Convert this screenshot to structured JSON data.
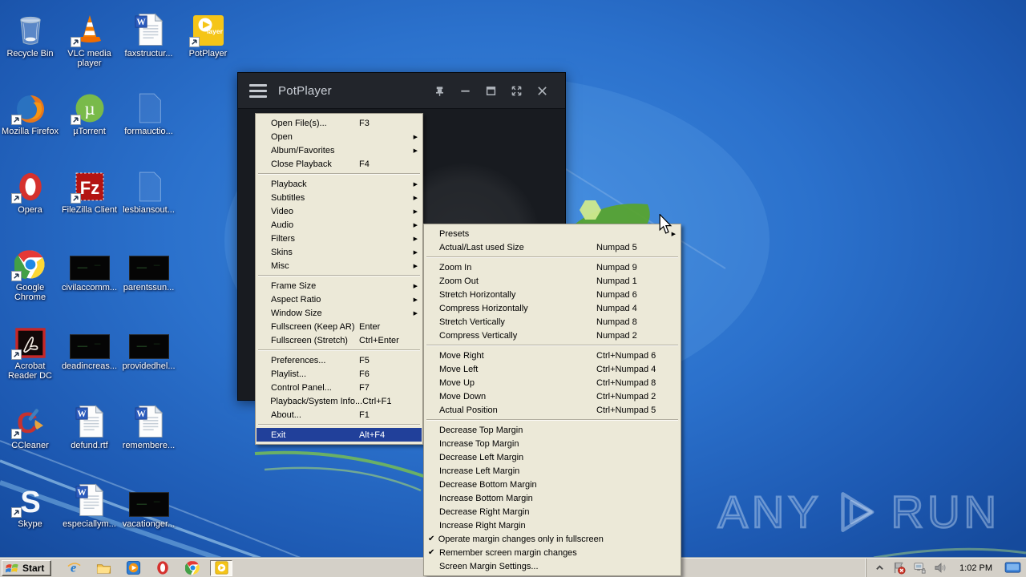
{
  "colors": {
    "menu_highlight": "#21409a",
    "menu_background": "#ece9d8",
    "titlebar": "#22252b",
    "taskbar": "#d4d0c8",
    "potplayer_yellow": "#f5c518",
    "wallpaper_base": "#2b71cc"
  },
  "window": {
    "title": "PotPlayer",
    "titlebar_icons": [
      "pin-icon",
      "minimize-icon",
      "maximize-icon",
      "fullscreen-icon",
      "close-icon"
    ]
  },
  "menus": {
    "main": {
      "items": [
        {
          "label": "Open File(s)...",
          "shortcut": "F3"
        },
        {
          "label": "Open",
          "submenu": true
        },
        {
          "label": "Album/Favorites",
          "submenu": true
        },
        {
          "label": "Close Playback",
          "shortcut": "F4"
        },
        {
          "separator": true
        },
        {
          "label": "Playback",
          "submenu": true
        },
        {
          "label": "Subtitles",
          "submenu": true
        },
        {
          "label": "Video",
          "submenu": true
        },
        {
          "label": "Audio",
          "submenu": true
        },
        {
          "label": "Filters",
          "submenu": true
        },
        {
          "label": "Skins",
          "submenu": true
        },
        {
          "label": "Misc",
          "submenu": true
        },
        {
          "separator": true
        },
        {
          "label": "Frame Size",
          "submenu": true
        },
        {
          "label": "Aspect Ratio",
          "submenu": true
        },
        {
          "label": "Window Size",
          "submenu": true
        },
        {
          "label": "Fullscreen (Keep AR)",
          "shortcut": "Enter"
        },
        {
          "label": "Fullscreen (Stretch)",
          "shortcut": "Ctrl+Enter"
        },
        {
          "separator": true
        },
        {
          "label": "Preferences...",
          "shortcut": "F5"
        },
        {
          "label": "Playlist...",
          "shortcut": "F6"
        },
        {
          "label": "Control Panel...",
          "shortcut": "F7"
        },
        {
          "label": "Playback/System Info...",
          "shortcut": "Ctrl+F1"
        },
        {
          "label": "About...",
          "shortcut": "F1"
        },
        {
          "separator": true
        },
        {
          "label": "Exit",
          "shortcut": "Alt+F4",
          "highlighted": true
        }
      ]
    },
    "window_size": {
      "items": [
        {
          "label": "Presets",
          "submenu": true
        },
        {
          "label": "Actual/Last used Size",
          "shortcut": "Numpad 5"
        },
        {
          "separator": true
        },
        {
          "label": "Zoom In",
          "shortcut": "Numpad 9"
        },
        {
          "label": "Zoom Out",
          "shortcut": "Numpad 1"
        },
        {
          "label": "Stretch Horizontally",
          "shortcut": "Numpad 6"
        },
        {
          "label": "Compress Horizontally",
          "shortcut": "Numpad 4"
        },
        {
          "label": "Stretch Vertically",
          "shortcut": "Numpad 8"
        },
        {
          "label": "Compress Vertically",
          "shortcut": "Numpad 2"
        },
        {
          "separator": true
        },
        {
          "label": "Move Right",
          "shortcut": "Ctrl+Numpad 6"
        },
        {
          "label": "Move Left",
          "shortcut": "Ctrl+Numpad 4"
        },
        {
          "label": "Move Up",
          "shortcut": "Ctrl+Numpad 8"
        },
        {
          "label": "Move Down",
          "shortcut": "Ctrl+Numpad 2"
        },
        {
          "label": "Actual Position",
          "shortcut": "Ctrl+Numpad 5"
        },
        {
          "separator": true
        },
        {
          "label": "Decrease Top Margin"
        },
        {
          "label": "Increase Top Margin"
        },
        {
          "label": "Decrease Left Margin"
        },
        {
          "label": "Increase Left Margin"
        },
        {
          "label": "Decrease Bottom Margin"
        },
        {
          "label": "Increase Bottom Margin"
        },
        {
          "label": "Decrease Right Margin"
        },
        {
          "label": "Increase Right Margin"
        },
        {
          "label": "Operate margin changes only in fullscreen",
          "checked": true
        },
        {
          "label": "Remember screen margin changes",
          "checked": true
        },
        {
          "label": "Screen Margin Settings..."
        }
      ]
    }
  },
  "desktop": {
    "icons": [
      {
        "label": "Recycle Bin",
        "icon": "recycle-bin",
        "col": 0,
        "row": 0
      },
      {
        "label": "VLC media player",
        "icon": "vlc",
        "col": 1,
        "row": 0,
        "shortcut": true
      },
      {
        "label": "faxstructur...",
        "icon": "word-document",
        "col": 2,
        "row": 0
      },
      {
        "label": "PotPlayer",
        "icon": "potplayer",
        "col": 3,
        "row": 0,
        "shortcut": true
      },
      {
        "label": "Mozilla Firefox",
        "icon": "firefox",
        "col": 0,
        "row": 1,
        "shortcut": true
      },
      {
        "label": "µTorrent",
        "icon": "utorrent",
        "col": 1,
        "row": 1,
        "shortcut": true
      },
      {
        "label": "formauctio...",
        "icon": "ghost-file",
        "col": 2,
        "row": 1
      },
      {
        "label": "Opera",
        "icon": "opera",
        "col": 0,
        "row": 2,
        "shortcut": true
      },
      {
        "label": "FileZilla Client",
        "icon": "filezilla",
        "col": 1,
        "row": 2,
        "shortcut": true
      },
      {
        "label": "lesbiansout...",
        "icon": "ghost-file",
        "col": 2,
        "row": 2
      },
      {
        "label": "Google Chrome",
        "icon": "chrome",
        "col": 0,
        "row": 3,
        "shortcut": true
      },
      {
        "label": "civilaccomm...",
        "icon": "video-thumbnail",
        "col": 1,
        "row": 3
      },
      {
        "label": "parentssun...",
        "icon": "video-thumbnail",
        "col": 2,
        "row": 3
      },
      {
        "label": "Acrobat Reader DC",
        "icon": "acrobat-reader",
        "col": 0,
        "row": 4,
        "shortcut": true
      },
      {
        "label": "deadincreas...",
        "icon": "video-thumbnail",
        "col": 1,
        "row": 4
      },
      {
        "label": "providedhel...",
        "icon": "video-thumbnail",
        "col": 2,
        "row": 4
      },
      {
        "label": "CCleaner",
        "icon": "ccleaner",
        "col": 0,
        "row": 5,
        "shortcut": true
      },
      {
        "label": "defund.rtf",
        "icon": "word-document",
        "col": 1,
        "row": 5
      },
      {
        "label": "remembere...",
        "icon": "word-document",
        "col": 2,
        "row": 5
      },
      {
        "label": "Skype",
        "icon": "skype",
        "col": 0,
        "row": 6,
        "shortcut": true
      },
      {
        "label": "especiallym...",
        "icon": "word-document",
        "col": 1,
        "row": 6
      },
      {
        "label": "vacationger...",
        "icon": "video-thumbnail",
        "col": 2,
        "row": 6
      }
    ]
  },
  "taskbar": {
    "start_label": "Start",
    "quick_launch": [
      {
        "name": "internet-explorer"
      },
      {
        "name": "windows-explorer"
      },
      {
        "name": "windows-media-player"
      },
      {
        "name": "opera"
      },
      {
        "name": "google-chrome"
      }
    ],
    "active_task": {
      "name": "potplayer"
    },
    "tray": {
      "icons": [
        "collapse-chevron-icon",
        "action-center-flag-icon",
        "network-icon",
        "volume-icon"
      ],
      "time": "1:02 PM",
      "show_desktop": "show-desktop-icon"
    }
  },
  "watermark": {
    "left": "ANY",
    "right": "RUN"
  }
}
